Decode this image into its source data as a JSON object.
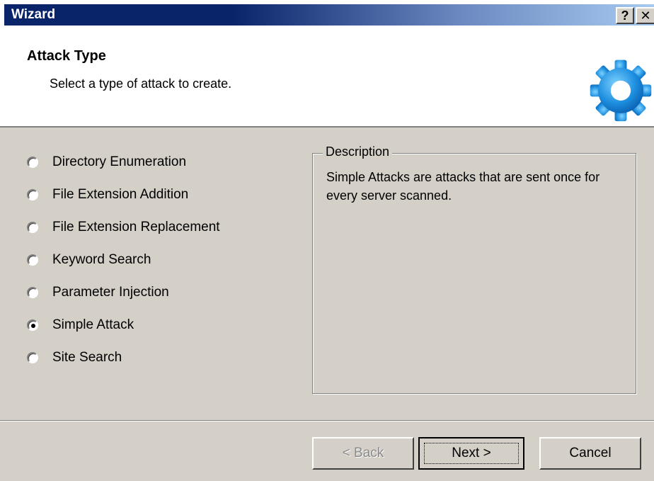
{
  "window": {
    "title": "Wizard",
    "help_label": "?",
    "close_label": "✕"
  },
  "header": {
    "title": "Attack Type",
    "subtitle": "Select a type of attack to create."
  },
  "attack_types": [
    {
      "label": "Directory Enumeration",
      "selected": false
    },
    {
      "label": "File Extension Addition",
      "selected": false
    },
    {
      "label": "File Extension Replacement",
      "selected": false
    },
    {
      "label": "Keyword Search",
      "selected": false
    },
    {
      "label": "Parameter Injection",
      "selected": false
    },
    {
      "label": "Simple Attack",
      "selected": true
    },
    {
      "label": "Site Search",
      "selected": false
    }
  ],
  "description": {
    "legend": "Description",
    "text": "Simple Attacks are attacks that are sent once for every server scanned."
  },
  "buttons": {
    "back_label": "< Back",
    "next_label": "Next >",
    "cancel_label": "Cancel"
  },
  "colors": {
    "title_bar": "#0a246a",
    "face": "#d4d0c8",
    "gear": "#1e90e0"
  }
}
